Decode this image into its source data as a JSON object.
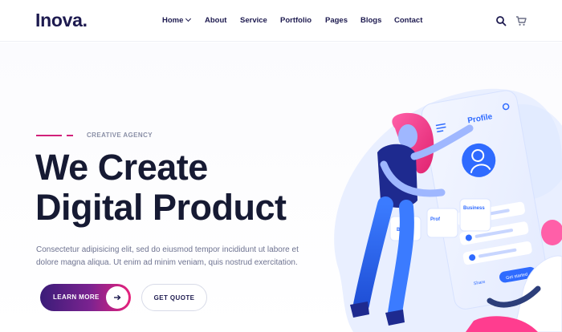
{
  "brand": {
    "name": "Inova",
    "dot": "."
  },
  "nav": {
    "items": [
      {
        "label": "Home",
        "has_dropdown": true
      },
      {
        "label": "About"
      },
      {
        "label": "Service"
      },
      {
        "label": "Portfolio"
      },
      {
        "label": "Pages"
      },
      {
        "label": "Blogs"
      },
      {
        "label": "Contact"
      }
    ],
    "icons": [
      "search-icon",
      "cart-icon"
    ]
  },
  "hero": {
    "tagline": "CREATIVE AGENCY",
    "headline_line1": "We Create",
    "headline_line2": "Digital Product",
    "description": "Consectetur adipisicing elit, sed do eiusmod tempor incididunt ut labore et dolore magna aliqua. Ut enim ad minim veniam, quis nostrud exercitation.",
    "primary_button": "LEARN MORE",
    "secondary_button": "GET QUOTE"
  },
  "illustration": {
    "profile_title": "Profile",
    "cards": [
      "Basic",
      "Prof",
      "Business"
    ],
    "share_label": "Share",
    "get_started_label": "Get started"
  },
  "colors": {
    "brand_dark": "#1d1a4f",
    "accent_pink": "#e8227c",
    "accent_purple": "#3a1c78",
    "illustration_blue": "#2f6bff"
  }
}
